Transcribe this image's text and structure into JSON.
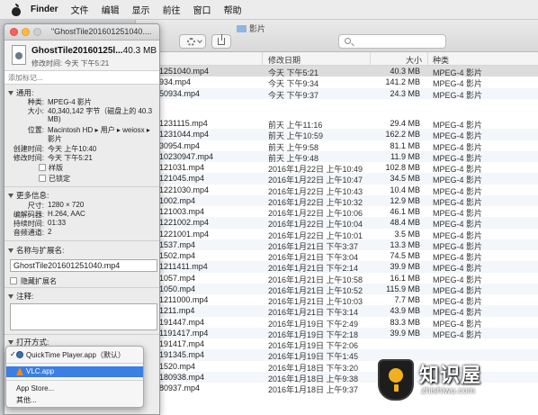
{
  "menubar": {
    "items": [
      "Finder",
      "文件",
      "编辑",
      "显示",
      "前往",
      "窗口",
      "帮助"
    ]
  },
  "finder": {
    "folder_title": "影片",
    "search_placeholder": "",
    "columns": {
      "name": "",
      "date": "修改日期",
      "size": "大小",
      "kind": "种类"
    },
    "rows": [
      {
        "name": "1251040.mp4",
        "date": "今天 下午5:21",
        "size": "40.3 MB",
        "kind": "MPEG-4 影片",
        "selected": true
      },
      {
        "name": "934.mp4",
        "date": "今天 下午9:34",
        "size": "141.2 MB",
        "kind": "MPEG-4 影片"
      },
      {
        "name": "50934.mp4",
        "date": "今天 下午9:37",
        "size": "24.3 MB",
        "kind": "MPEG-4 影片"
      },
      {
        "name": "1231115.mp4",
        "date": "前天 上午11:16",
        "size": "29.4 MB",
        "kind": "MPEG-4 影片"
      },
      {
        "name": "1231044.mp4",
        "date": "前天 上午10:59",
        "size": "162.2 MB",
        "kind": "MPEG-4 影片"
      },
      {
        "name": "30954.mp4",
        "date": "前天 上午9:58",
        "size": "81.1 MB",
        "kind": "MPEG-4 影片"
      },
      {
        "name": "10230947.mp4",
        "date": "前天 上午9:48",
        "size": "11.9 MB",
        "kind": "MPEG-4 影片"
      },
      {
        "name": "121031.mp4",
        "date": "2016年1月22日 上午10:49",
        "size": "102.8 MB",
        "kind": "MPEG-4 影片"
      },
      {
        "name": "121045.mp4",
        "date": "2016年1月22日 上午10:47",
        "size": "34.5 MB",
        "kind": "MPEG-4 影片"
      },
      {
        "name": "1221030.mp4",
        "date": "2016年1月22日 上午10:43",
        "size": "10.4 MB",
        "kind": "MPEG-4 影片"
      },
      {
        "name": "1002.mp4",
        "date": "2016年1月22日 上午10:32",
        "size": "12.9 MB",
        "kind": "MPEG-4 影片"
      },
      {
        "name": "121003.mp4",
        "date": "2016年1月22日 上午10:06",
        "size": "46.1 MB",
        "kind": "MPEG-4 影片"
      },
      {
        "name": "1221002.mp4",
        "date": "2016年1月22日 上午10:04",
        "size": "48.4 MB",
        "kind": "MPEG-4 影片"
      },
      {
        "name": "1221001.mp4",
        "date": "2016年1月22日 上午10:01",
        "size": "3.5 MB",
        "kind": "MPEG-4 影片"
      },
      {
        "name": "1537.mp4",
        "date": "2016年1月21日 下午3:37",
        "size": "13.3 MB",
        "kind": "MPEG-4 影片"
      },
      {
        "name": "1502.mp4",
        "date": "2016年1月21日 下午3:04",
        "size": "74.5 MB",
        "kind": "MPEG-4 影片"
      },
      {
        "name": "1211411.mp4",
        "date": "2016年1月21日 下午2:14",
        "size": "39.9 MB",
        "kind": "MPEG-4 影片"
      },
      {
        "name": "1057.mp4",
        "date": "2016年1月21日 上午10:58",
        "size": "16.1 MB",
        "kind": "MPEG-4 影片"
      },
      {
        "name": "1050.mp4",
        "date": "2016年1月21日 上午10:52",
        "size": "115.9 MB",
        "kind": "MPEG-4 影片"
      },
      {
        "name": "1211000.mp4",
        "date": "2016年1月21日 上午10:03",
        "size": "7.7 MB",
        "kind": "MPEG-4 影片"
      },
      {
        "name": "1211.mp4",
        "date": "2016年1月21日 下午3:14",
        "size": "43.9 MB",
        "kind": "MPEG-4 影片"
      },
      {
        "name": "191447.mp4",
        "date": "2016年1月19日 下午2:49",
        "size": "83.3 MB",
        "kind": "MPEG-4 影片"
      },
      {
        "name": "1191417.mp4",
        "date": "2016年1月19日 下午2:18",
        "size": "39.9 MB",
        "kind": "MPEG-4 影片"
      },
      {
        "name": "191417.mp4",
        "date": "2016年1月19日 下午2:06",
        "size": "",
        "kind": ""
      },
      {
        "name": "191345.mp4",
        "date": "2016年1月19日 下午1:45",
        "size": "",
        "kind": ""
      },
      {
        "name": "1520.mp4",
        "date": "2016年1月18日 下午3:20",
        "size": "",
        "kind": ""
      },
      {
        "name": "180938.mp4",
        "date": "2016年1月18日 上午9:38",
        "size": "",
        "kind": ""
      },
      {
        "name": "80937.mp4",
        "date": "2016年1月18日 上午9:37",
        "size": "",
        "kind": ""
      }
    ]
  },
  "info": {
    "window_title": "\"GhostTile201601251040....",
    "file_name": "GhostTile20160125l...",
    "file_size": "40.3 MB",
    "modified_line": "修改时间: 今天 下午5:21",
    "tag_placeholder": "添加标记...",
    "general": {
      "header": "通用:",
      "kind_k": "种类:",
      "kind_v": "MPEG-4 影片",
      "size_k": "大小:",
      "size_v1": "40,340,142 字节（磁盘上的 40.3",
      "size_v2": "MB)",
      "where_k": "位置:",
      "where_v1": "Macintosh HD ▸ 用户 ▸ weiosx ▸",
      "where_v2": "影片",
      "created_k": "创建时间:",
      "created_v": "今天 上午10:40",
      "modified_k": "修改时间:",
      "modified_v": "今天 下午5:21",
      "stationery": "样版",
      "locked": "已锁定"
    },
    "more": {
      "header": "更多信息:",
      "dim_k": "尺寸:",
      "dim_v": "1280 × 720",
      "codec_k": "编解码器:",
      "codec_v": "H.264, AAC",
      "duration_k": "持续时间:",
      "duration_v": "01:33",
      "channels_k": "音频通道:",
      "channels_v": "2"
    },
    "name_ext": {
      "header": "名称与扩展名:",
      "value": "GhostTile201601251040.mp4",
      "hide_ext": "隐藏扩展名"
    },
    "comments_header": "注释:",
    "open_with_header": "打开方式:"
  },
  "open_menu": {
    "items": [
      {
        "label": "QuickTime Player.app（默认）",
        "checked": true
      },
      {
        "label": "VLC.app",
        "highlighted": true
      },
      {
        "label": "App Store..."
      },
      {
        "label": "其他..."
      }
    ],
    "check_mark": "✓"
  },
  "watermark": {
    "title": "知识屋",
    "subtitle": "zhishiwu.com"
  }
}
